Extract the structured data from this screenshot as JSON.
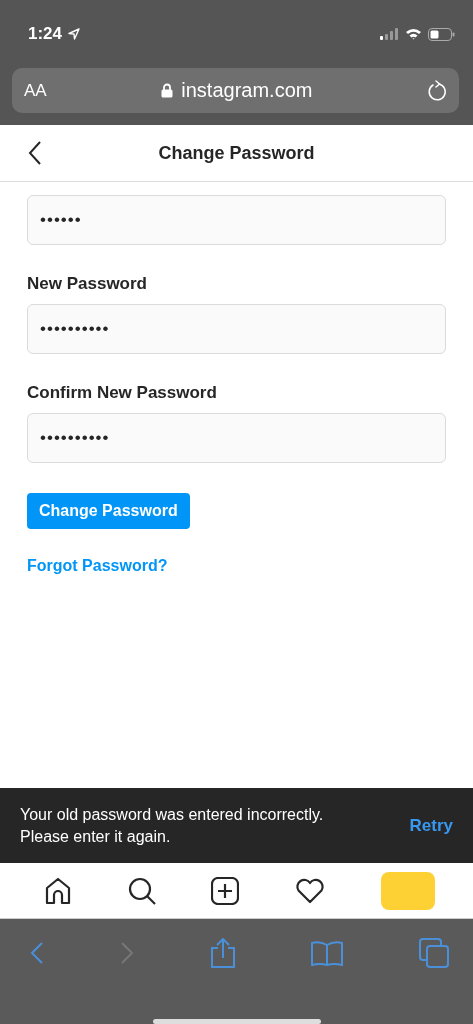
{
  "status_bar": {
    "time": "1:24"
  },
  "address_bar": {
    "text_size": "AA",
    "url": "instagram.com"
  },
  "header": {
    "title": "Change Password"
  },
  "fields": [
    {
      "value": "••••••"
    },
    {
      "label": "New Password",
      "value": "••••••••••"
    },
    {
      "label": "Confirm New Password",
      "value": "••••••••••"
    }
  ],
  "submit_button": "Change Password",
  "forgot_link": "Forgot Password?",
  "toast": {
    "message": "Your old password was entered incorrectly. Please enter it again.",
    "action": "Retry"
  },
  "tab_bar": [
    {
      "kind": "home"
    },
    {
      "kind": "search"
    },
    {
      "kind": "new-post"
    },
    {
      "kind": "activity"
    },
    {
      "kind": "redacted"
    }
  ],
  "browser_toolbar": [
    {
      "kind": "back",
      "disabled": false
    },
    {
      "kind": "forward",
      "disabled": true
    },
    {
      "kind": "share",
      "disabled": false
    },
    {
      "kind": "bookmarks",
      "disabled": false
    },
    {
      "kind": "tabs",
      "disabled": false
    }
  ]
}
